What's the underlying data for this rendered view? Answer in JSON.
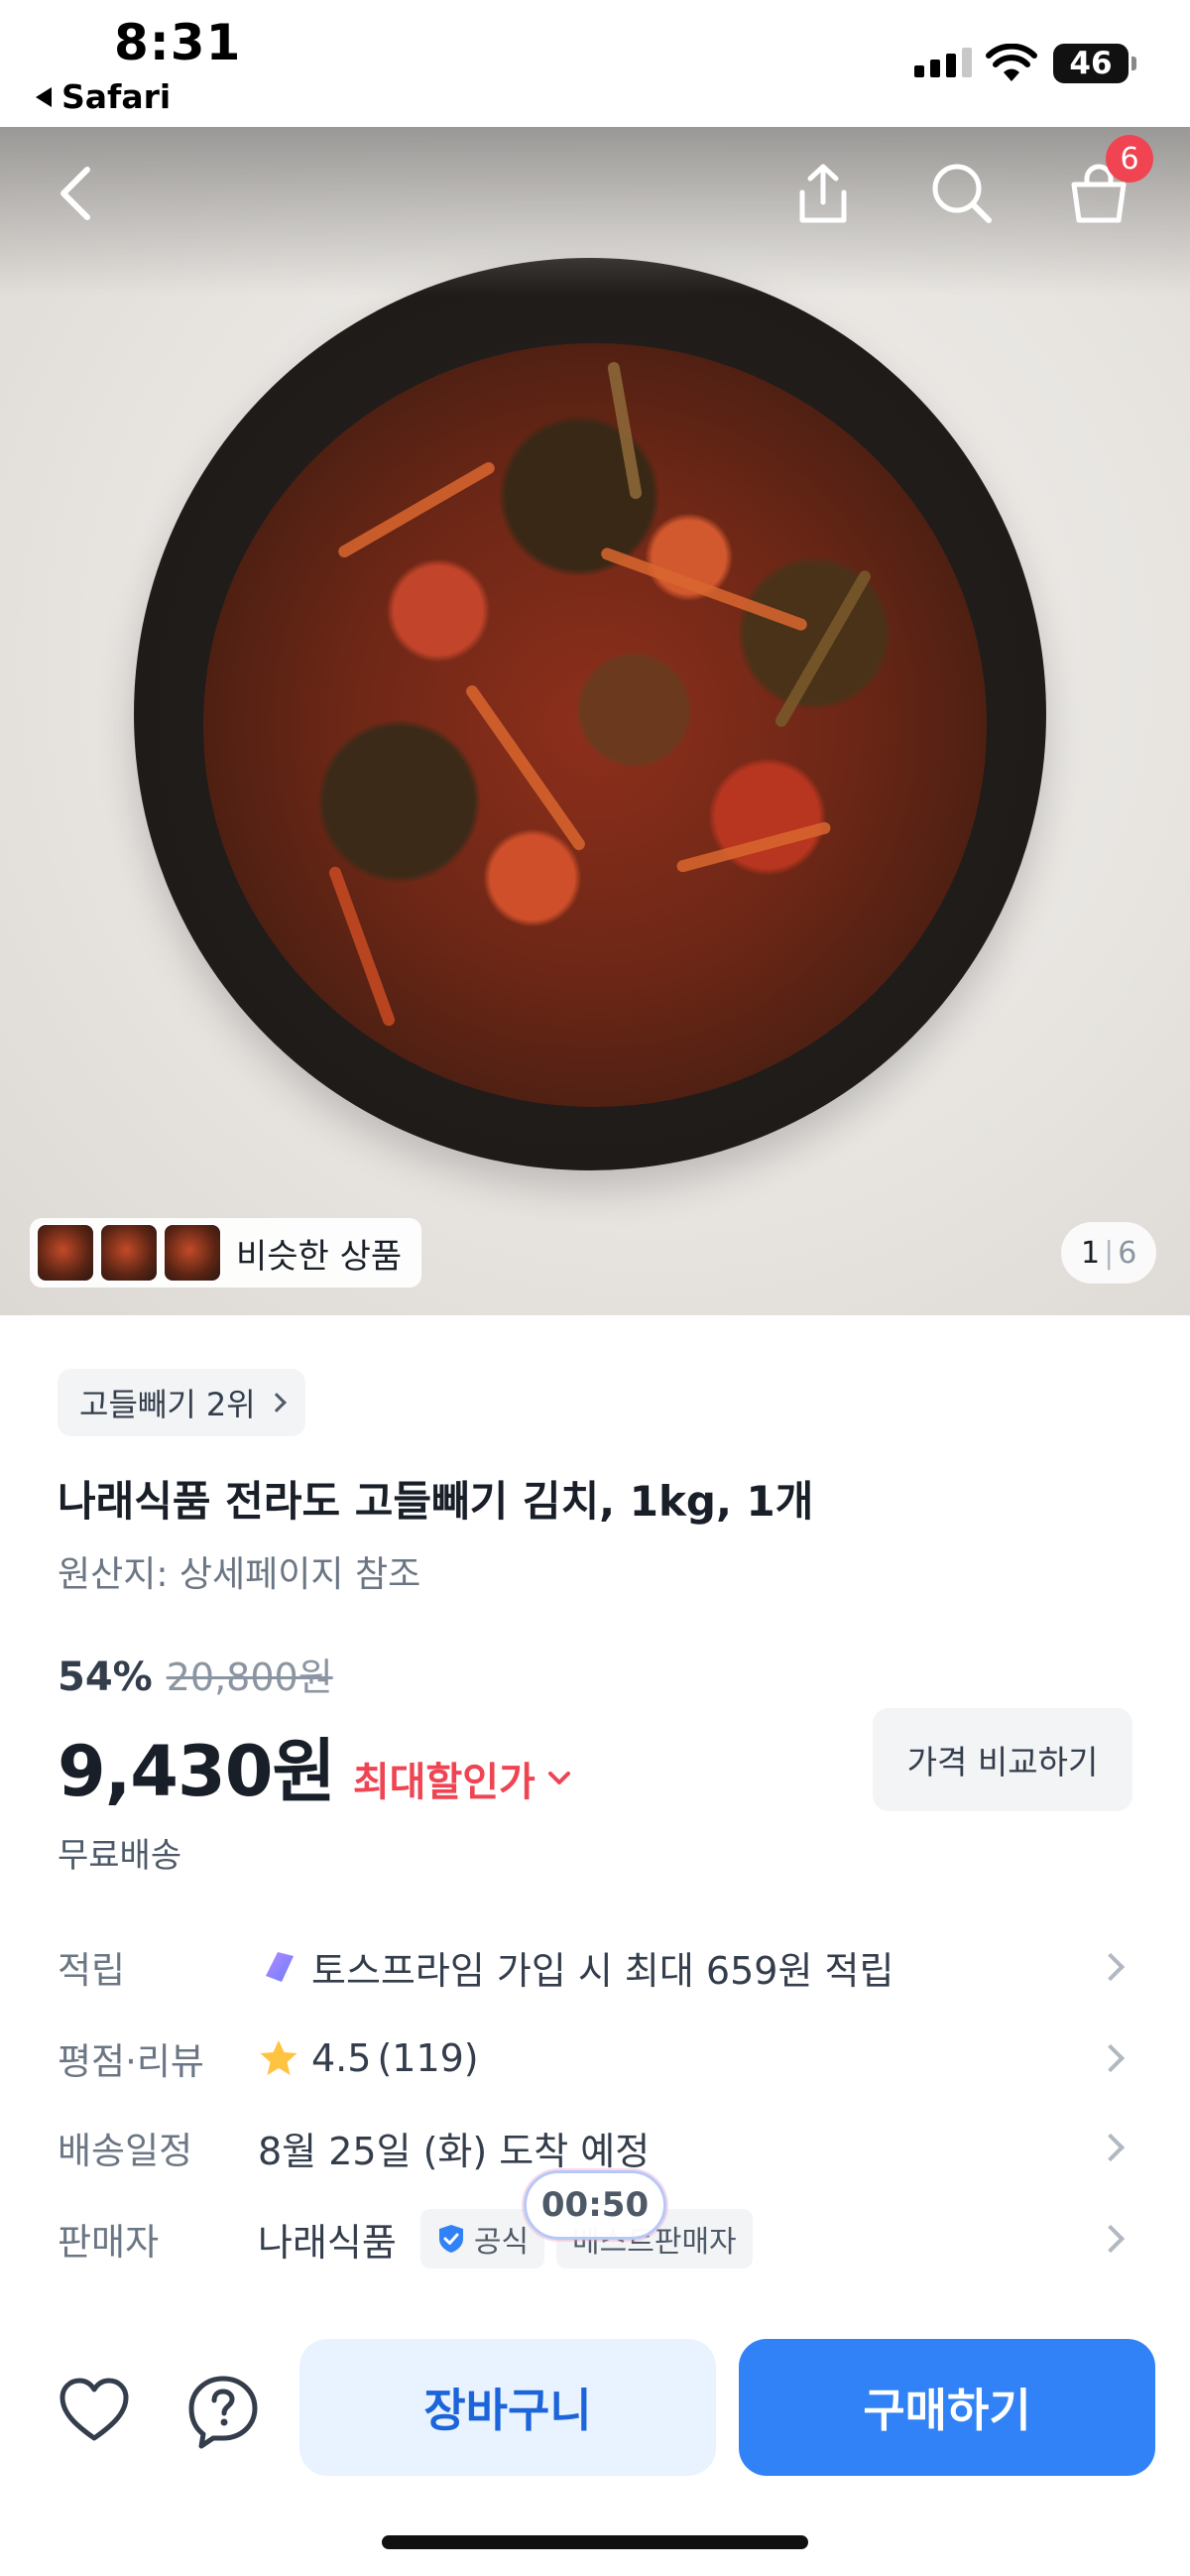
{
  "status_bar": {
    "time": "8:31",
    "back_app": "Safari",
    "battery": "46"
  },
  "header": {
    "cart_count": "6",
    "icons": [
      "back-icon",
      "share-icon",
      "search-icon",
      "cart-icon"
    ]
  },
  "gallery": {
    "similar_label": "비슷한 상품",
    "current_page": "1",
    "separator": "|",
    "total_pages": "6"
  },
  "product": {
    "rank_chip": "고들빼기 2위",
    "title": "나래식품 전라도 고들빼기 김치, 1kg, 1개",
    "origin": "원산지: 상세페이지 참조",
    "discount_rate": "54%",
    "original_price": "20,800원",
    "price": "9,430원",
    "max_discount_label": "최대할인가",
    "compare_button": "가격 비교하기",
    "shipping": "무료배송"
  },
  "info_rows": {
    "points": {
      "label": "적립",
      "value": "토스프라임 가입 시 최대 659원 적립"
    },
    "rating": {
      "label": "평점·리뷰",
      "score": "4.5",
      "count": "(119)"
    },
    "delivery": {
      "label": "배송일정",
      "value": "8월 25일 (화) 도착 예정"
    },
    "seller": {
      "label": "판매자",
      "value": "나래식품",
      "official_badge": "공식",
      "best_badge": "베스트판매자"
    }
  },
  "timer": "00:50",
  "bottom_bar": {
    "cart_button": "장바구니",
    "buy_button": "구매하기"
  },
  "colors": {
    "accent": "#3182f6",
    "accent_light": "#e8f3ff",
    "sale_red": "#f04452",
    "star": "#ffc342"
  }
}
